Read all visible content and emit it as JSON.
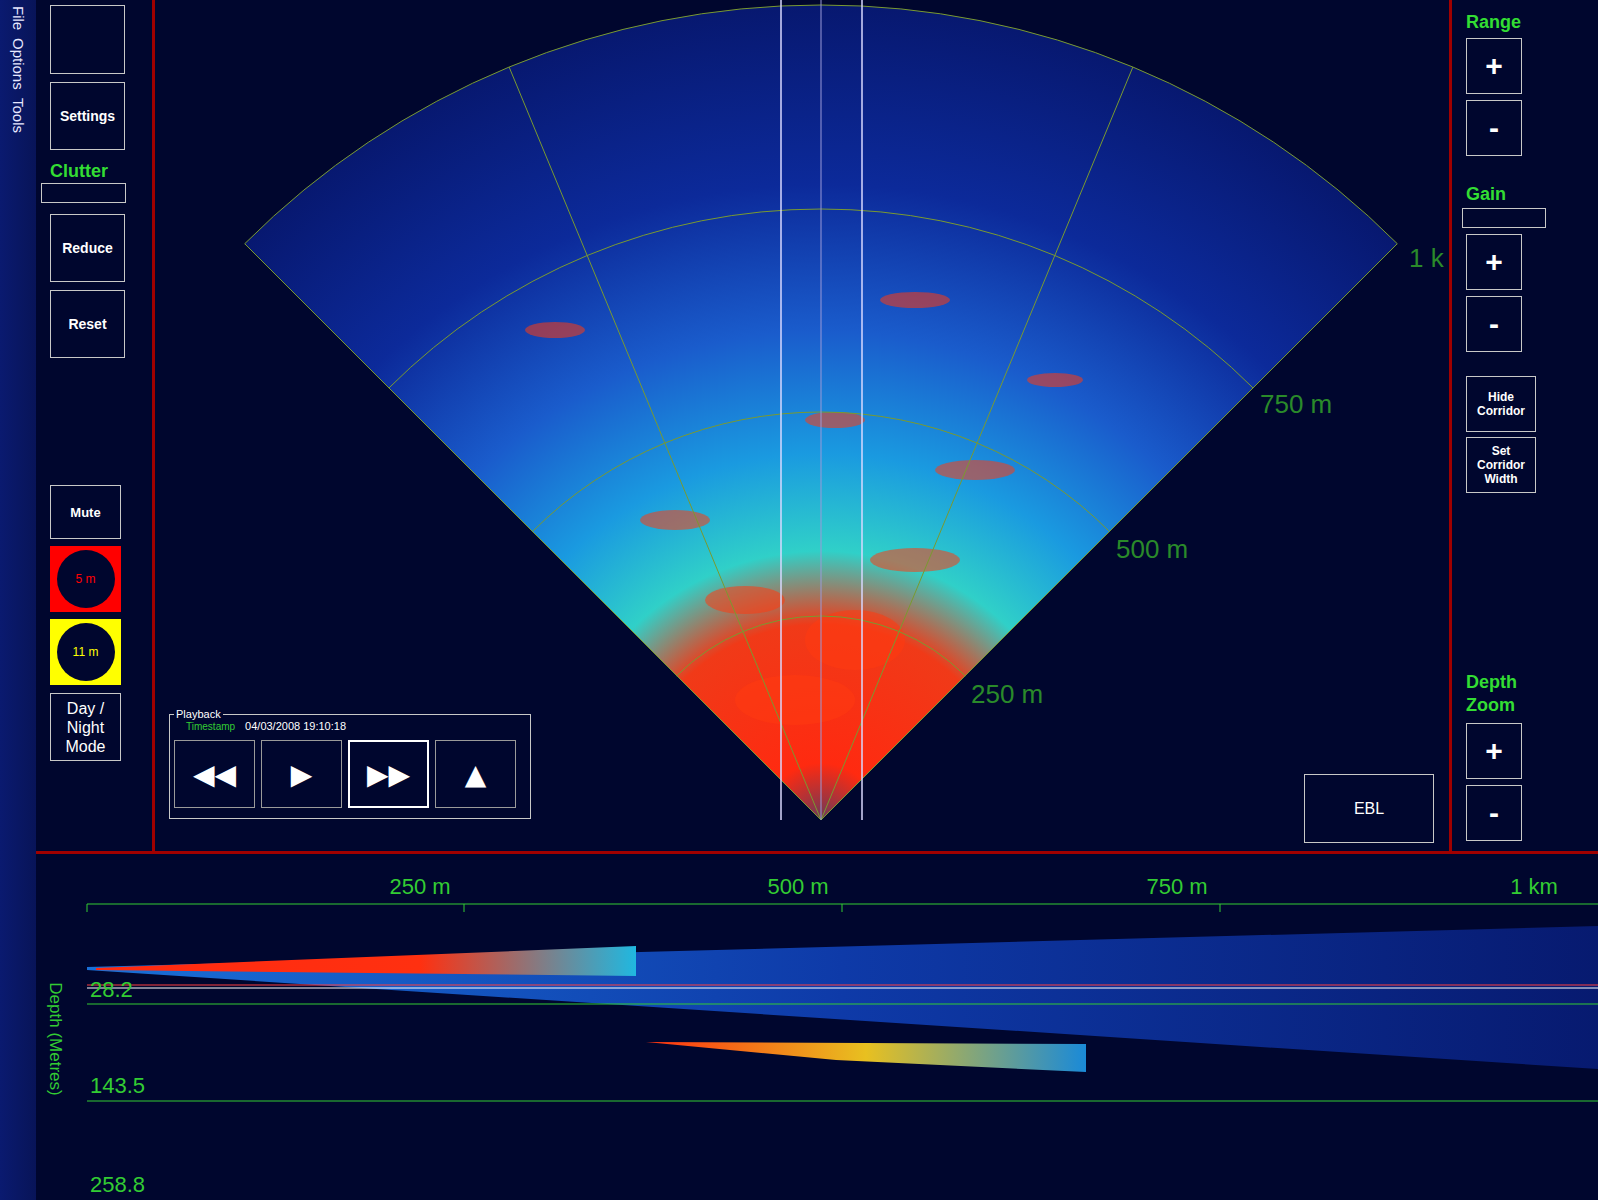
{
  "menu": [
    "File",
    "Options",
    "Tools"
  ],
  "left_panel": {
    "settings": "Settings",
    "clutter": {
      "label": "Clutter",
      "value": ""
    },
    "reduce": "Reduce",
    "reset": "Reset",
    "mute": "Mute",
    "alarms": [
      {
        "label": "5 m",
        "color": "#ff0000"
      },
      {
        "label": "11 m",
        "color": "#ffff00"
      }
    ],
    "day_night": "Day / Night Mode"
  },
  "sonar": {
    "range_labels": [
      "250 m",
      "500 m",
      "750 m",
      "1 k"
    ]
  },
  "playback": {
    "title": "Playback",
    "timestamp_label": "Timestamp",
    "timestamp": "04/03/2008 19:10:18",
    "controls": [
      {
        "label": "◀◀",
        "selected": false
      },
      {
        "label": "▶",
        "selected": false
      },
      {
        "label": "▶▶",
        "selected": true
      },
      {
        "label": "▲",
        "selected": false
      }
    ]
  },
  "ebl": "EBL",
  "right_panel": {
    "range": {
      "label": "Range",
      "buttons": [
        "+",
        "-"
      ]
    },
    "gain": {
      "label": "Gain",
      "value": "",
      "buttons": [
        "+",
        "-"
      ]
    },
    "corridor_buttons": [
      "Hide Corridor",
      "Set Corridor Width"
    ],
    "depth_zoom": {
      "label": "Depth Zoom",
      "buttons": [
        "+",
        "-"
      ]
    }
  },
  "profile": {
    "axis_labels": [
      "250 m",
      "500 m",
      "750 m",
      "1 km"
    ],
    "depth_label": "Depth (Metres)",
    "depths": [
      "28.2",
      "143.5",
      "258.8"
    ]
  }
}
